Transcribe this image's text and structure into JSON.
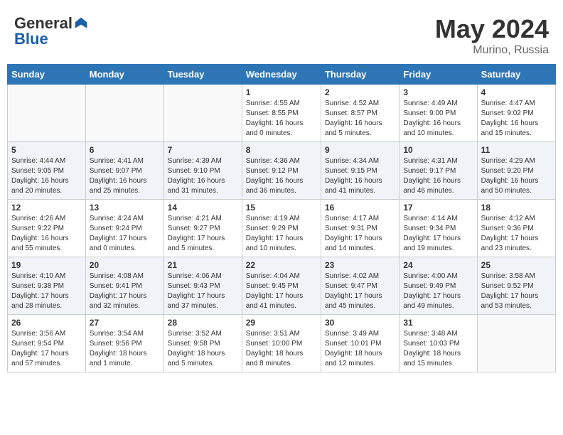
{
  "logo": {
    "general": "General",
    "blue": "Blue"
  },
  "title": "May 2024",
  "subtitle": "Murino, Russia",
  "weekdays": [
    "Sunday",
    "Monday",
    "Tuesday",
    "Wednesday",
    "Thursday",
    "Friday",
    "Saturday"
  ],
  "weeks": [
    [
      {
        "day": "",
        "info": ""
      },
      {
        "day": "",
        "info": ""
      },
      {
        "day": "",
        "info": ""
      },
      {
        "day": "1",
        "info": "Sunrise: 4:55 AM\nSunset: 8:55 PM\nDaylight: 16 hours\nand 0 minutes."
      },
      {
        "day": "2",
        "info": "Sunrise: 4:52 AM\nSunset: 8:57 PM\nDaylight: 16 hours\nand 5 minutes."
      },
      {
        "day": "3",
        "info": "Sunrise: 4:49 AM\nSunset: 9:00 PM\nDaylight: 16 hours\nand 10 minutes."
      },
      {
        "day": "4",
        "info": "Sunrise: 4:47 AM\nSunset: 9:02 PM\nDaylight: 16 hours\nand 15 minutes."
      }
    ],
    [
      {
        "day": "5",
        "info": "Sunrise: 4:44 AM\nSunset: 9:05 PM\nDaylight: 16 hours\nand 20 minutes."
      },
      {
        "day": "6",
        "info": "Sunrise: 4:41 AM\nSunset: 9:07 PM\nDaylight: 16 hours\nand 25 minutes."
      },
      {
        "day": "7",
        "info": "Sunrise: 4:39 AM\nSunset: 9:10 PM\nDaylight: 16 hours\nand 31 minutes."
      },
      {
        "day": "8",
        "info": "Sunrise: 4:36 AM\nSunset: 9:12 PM\nDaylight: 16 hours\nand 36 minutes."
      },
      {
        "day": "9",
        "info": "Sunrise: 4:34 AM\nSunset: 9:15 PM\nDaylight: 16 hours\nand 41 minutes."
      },
      {
        "day": "10",
        "info": "Sunrise: 4:31 AM\nSunset: 9:17 PM\nDaylight: 16 hours\nand 46 minutes."
      },
      {
        "day": "11",
        "info": "Sunrise: 4:29 AM\nSunset: 9:20 PM\nDaylight: 16 hours\nand 50 minutes."
      }
    ],
    [
      {
        "day": "12",
        "info": "Sunrise: 4:26 AM\nSunset: 9:22 PM\nDaylight: 16 hours\nand 55 minutes."
      },
      {
        "day": "13",
        "info": "Sunrise: 4:24 AM\nSunset: 9:24 PM\nDaylight: 17 hours\nand 0 minutes."
      },
      {
        "day": "14",
        "info": "Sunrise: 4:21 AM\nSunset: 9:27 PM\nDaylight: 17 hours\nand 5 minutes."
      },
      {
        "day": "15",
        "info": "Sunrise: 4:19 AM\nSunset: 9:29 PM\nDaylight: 17 hours\nand 10 minutes."
      },
      {
        "day": "16",
        "info": "Sunrise: 4:17 AM\nSunset: 9:31 PM\nDaylight: 17 hours\nand 14 minutes."
      },
      {
        "day": "17",
        "info": "Sunrise: 4:14 AM\nSunset: 9:34 PM\nDaylight: 17 hours\nand 19 minutes."
      },
      {
        "day": "18",
        "info": "Sunrise: 4:12 AM\nSunset: 9:36 PM\nDaylight: 17 hours\nand 23 minutes."
      }
    ],
    [
      {
        "day": "19",
        "info": "Sunrise: 4:10 AM\nSunset: 9:38 PM\nDaylight: 17 hours\nand 28 minutes."
      },
      {
        "day": "20",
        "info": "Sunrise: 4:08 AM\nSunset: 9:41 PM\nDaylight: 17 hours\nand 32 minutes."
      },
      {
        "day": "21",
        "info": "Sunrise: 4:06 AM\nSunset: 9:43 PM\nDaylight: 17 hours\nand 37 minutes."
      },
      {
        "day": "22",
        "info": "Sunrise: 4:04 AM\nSunset: 9:45 PM\nDaylight: 17 hours\nand 41 minutes."
      },
      {
        "day": "23",
        "info": "Sunrise: 4:02 AM\nSunset: 9:47 PM\nDaylight: 17 hours\nand 45 minutes."
      },
      {
        "day": "24",
        "info": "Sunrise: 4:00 AM\nSunset: 9:49 PM\nDaylight: 17 hours\nand 49 minutes."
      },
      {
        "day": "25",
        "info": "Sunrise: 3:58 AM\nSunset: 9:52 PM\nDaylight: 17 hours\nand 53 minutes."
      }
    ],
    [
      {
        "day": "26",
        "info": "Sunrise: 3:56 AM\nSunset: 9:54 PM\nDaylight: 17 hours\nand 57 minutes."
      },
      {
        "day": "27",
        "info": "Sunrise: 3:54 AM\nSunset: 9:56 PM\nDaylight: 18 hours\nand 1 minute."
      },
      {
        "day": "28",
        "info": "Sunrise: 3:52 AM\nSunset: 9:58 PM\nDaylight: 18 hours\nand 5 minutes."
      },
      {
        "day": "29",
        "info": "Sunrise: 3:51 AM\nSunset: 10:00 PM\nDaylight: 18 hours\nand 8 minutes."
      },
      {
        "day": "30",
        "info": "Sunrise: 3:49 AM\nSunset: 10:01 PM\nDaylight: 18 hours\nand 12 minutes."
      },
      {
        "day": "31",
        "info": "Sunrise: 3:48 AM\nSunset: 10:03 PM\nDaylight: 18 hours\nand 15 minutes."
      },
      {
        "day": "",
        "info": ""
      }
    ]
  ]
}
